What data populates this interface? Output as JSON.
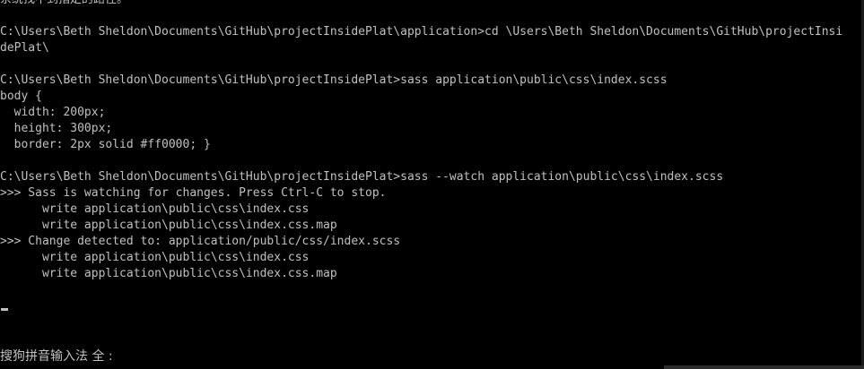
{
  "console": {
    "lines": [
      "系统找不到指定的路径。",
      "",
      "C:\\Users\\Beth Sheldon\\Documents\\GitHub\\projectInsidePlat\\application>cd \\Users\\Beth Sheldon\\Documents\\GitHub\\projectInsi",
      "dePlat\\",
      "",
      "C:\\Users\\Beth Sheldon\\Documents\\GitHub\\projectInsidePlat>sass application\\public\\css\\index.scss",
      "body {",
      "  width: 200px;",
      "  height: 300px;",
      "  border: 2px solid #ff0000; }",
      "",
      "C:\\Users\\Beth Sheldon\\Documents\\GitHub\\projectInsidePlat>sass --watch application\\public\\css\\index.scss",
      ">>> Sass is watching for changes. Press Ctrl-C to stop.",
      "      write application\\public\\css\\index.css",
      "      write application\\public\\css\\index.css.map",
      ">>> Change detected to: application/public/css/index.scss",
      "      write application\\public\\css\\index.css",
      "      write application\\public\\css\\index.css.map",
      ""
    ]
  },
  "ime": {
    "status": "搜狗拼音输入法 全 :"
  },
  "colors": {
    "background": "#000000",
    "text": "#c0c0c0"
  }
}
